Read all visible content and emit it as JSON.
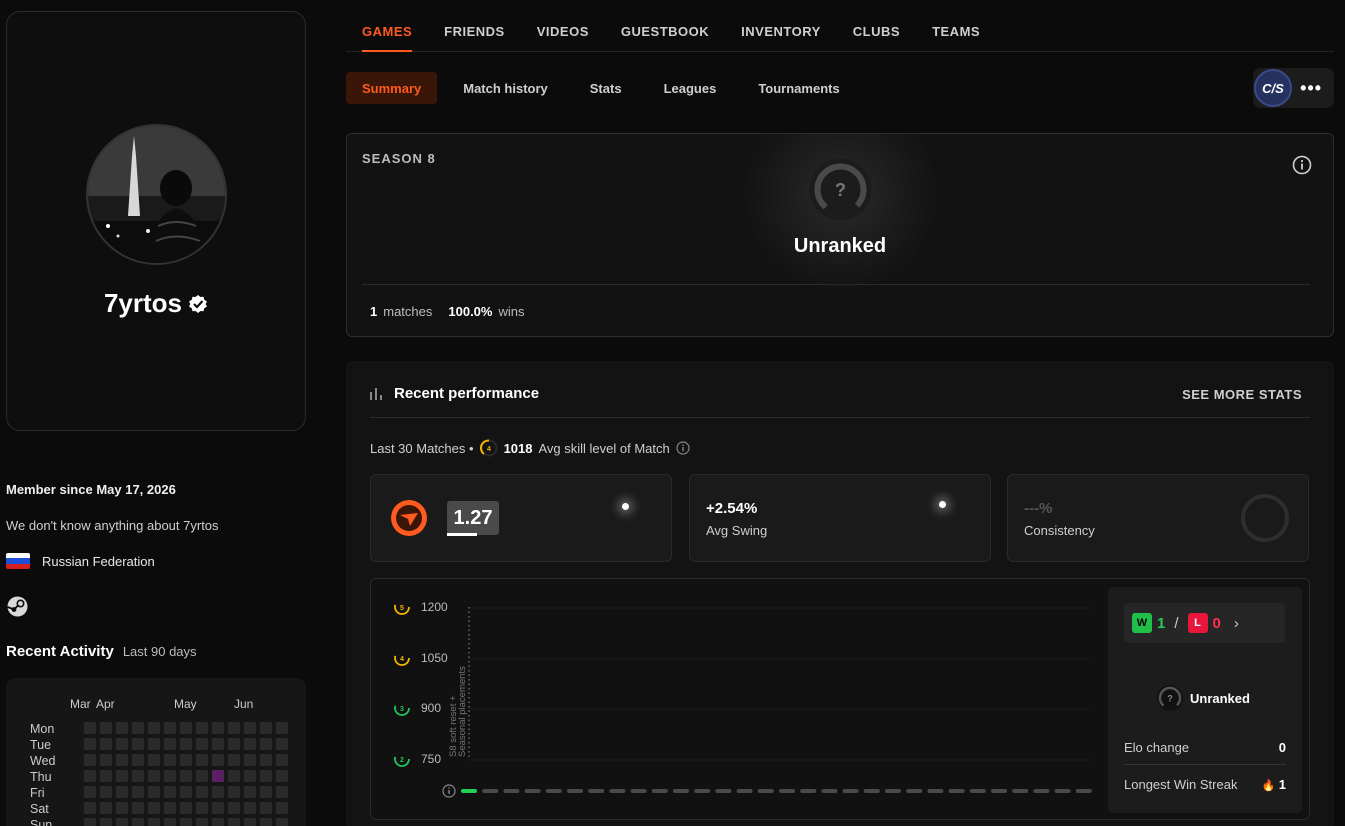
{
  "nav": {
    "main_tabs": [
      {
        "label": "GAMES",
        "active": true
      },
      {
        "label": "FRIENDS",
        "active": false
      },
      {
        "label": "VIDEOS",
        "active": false
      },
      {
        "label": "GUESTBOOK",
        "active": false
      },
      {
        "label": "INVENTORY",
        "active": false
      },
      {
        "label": "CLUBS",
        "active": false
      },
      {
        "label": "TEAMS",
        "active": false
      }
    ],
    "sub_tabs": [
      {
        "label": "Summary",
        "active": true
      },
      {
        "label": "Match history",
        "active": false
      },
      {
        "label": "Stats",
        "active": false
      },
      {
        "label": "Leagues",
        "active": false
      },
      {
        "label": "Tournaments",
        "active": false
      }
    ],
    "game_badge": "C/S",
    "more_label": "•••"
  },
  "profile": {
    "username": "7yrtos",
    "member_since": "Member since May 17, 2026",
    "bio": "We don't know anything about 7yrtos",
    "country": "Russian Federation"
  },
  "activity": {
    "title": "Recent Activity",
    "subtitle": "Last 90 days",
    "months": [
      "Mar",
      "Apr",
      "May",
      "Jun"
    ],
    "days": [
      "Mon",
      "Tue",
      "Wed",
      "Thu",
      "Fri",
      "Sat",
      "Sun"
    ]
  },
  "season": {
    "label": "SEASON 8",
    "rank_badge": "?",
    "rank": "Unranked",
    "matches_value": "1",
    "matches_label": "matches",
    "wins_value": "100.0%",
    "wins_label": "wins"
  },
  "performance": {
    "title": "Recent performance",
    "see_more": "SEE MORE STATS",
    "last30_label": "Last 30 Matches •",
    "avg_skill_badge": "4",
    "avg_skill_value": "1018",
    "avg_skill_label": "Avg skill level of Match",
    "kd_value": "1.27",
    "swing_value": "+2.54%",
    "swing_label": "Avg Swing",
    "consistency_value": "---%",
    "consistency_label": "Consistency",
    "chart": {
      "levels": [
        {
          "badge": "5",
          "value": "1200",
          "color": "#f5b400"
        },
        {
          "badge": "4",
          "value": "1050",
          "color": "#f5b400"
        },
        {
          "badge": "3",
          "value": "900",
          "color": "#22c55e"
        },
        {
          "badge": "2",
          "value": "750",
          "color": "#22c55e"
        }
      ],
      "annotation_line1": "S8 soft reset +",
      "annotation_line2": "Seasonal placements",
      "match_results": [
        "win"
      ],
      "total_slots": 30
    },
    "wl": {
      "w_badge": "W",
      "w_count": "1",
      "sep": "/",
      "l_badge": "L",
      "l_count": "0",
      "chevron": "›",
      "rank_badge": "?",
      "rank": "Unranked",
      "elo_label": "Elo change",
      "elo_value": "0",
      "streak_label": "Longest Win Streak",
      "streak_icon": "🔥",
      "streak_value": "1"
    }
  }
}
